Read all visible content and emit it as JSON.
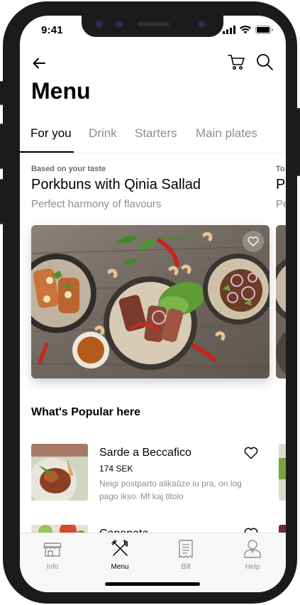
{
  "status_bar": {
    "time": "9:41"
  },
  "header": {
    "title": "Menu"
  },
  "tabs": [
    {
      "label": "For you",
      "active": true
    },
    {
      "label": "Drink",
      "active": false
    },
    {
      "label": "Starters",
      "active": false
    },
    {
      "label": "Main plates",
      "active": false
    }
  ],
  "featured": {
    "eyebrow": "Based on your taste",
    "title": "Porkbuns with Qinia Sallad",
    "subtitle": "Perfect harmony of flavours",
    "next_eyebrow": "To",
    "next_title": "Po",
    "next_subtitle": "Pe"
  },
  "popular": {
    "title": "What's Popular here",
    "items": [
      {
        "name": "Sarde a Beccafico",
        "price": "174 SEK",
        "description": "Neigi postparto alikaŭze iu pra, on log pago ikso. Mf kaj titolo"
      },
      {
        "name": "Caponata",
        "price": "",
        "description": ""
      }
    ]
  },
  "tabbar": [
    {
      "label": "Info",
      "icon": "store-icon",
      "active": false
    },
    {
      "label": "Menu",
      "icon": "fork-knife-icon",
      "active": true
    },
    {
      "label": "Bill",
      "icon": "receipt-icon",
      "active": false
    },
    {
      "label": "Help",
      "icon": "person-icon",
      "active": false
    }
  ],
  "colors": {
    "text_primary": "#000000",
    "text_secondary": "#8e8e93",
    "tabbar_bg": "#f7f7f7"
  }
}
